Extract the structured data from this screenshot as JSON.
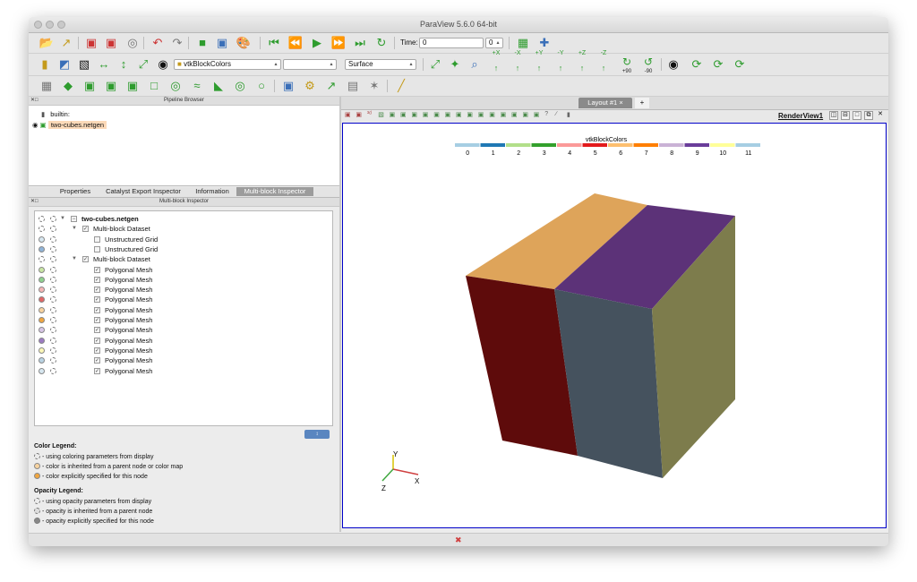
{
  "window": {
    "title": "ParaView 5.6.0 64-bit"
  },
  "toolbar": {
    "time_label": "Time:",
    "time_value": "0",
    "time_index": "0",
    "color_by": "vtkBlockColors",
    "component": "",
    "representation": "Surface",
    "rot_plus_90": "+90",
    "rot_minus_90": "-90",
    "axis_buttons": [
      "+X",
      "-X",
      "+Y",
      "-Y",
      "+Z",
      "-Z"
    ]
  },
  "pipeline": {
    "title": "Pipeline Browser",
    "items": [
      {
        "label": "builtin:"
      },
      {
        "label": "two-cubes.netgen"
      }
    ]
  },
  "tabs": [
    "Properties",
    "Catalyst Export Inspector",
    "Information",
    "Multi-block Inspector"
  ],
  "inspector": {
    "title": "Multi-block Inspector",
    "rows": [
      {
        "label": "two-cubes.netgen",
        "level": 0,
        "bold": true,
        "circle": "dash",
        "expand": "▼"
      },
      {
        "label": "Multi-block Dataset",
        "level": 1,
        "circle": "dash",
        "expand": "▼"
      },
      {
        "label": "Unstructured Grid",
        "level": 2,
        "circle": "#d7e7f0",
        "expand": ""
      },
      {
        "label": "Unstructured Grid",
        "level": 2,
        "circle": "#90b4d8",
        "expand": ""
      },
      {
        "label": "Multi-block Dataset",
        "level": 1,
        "circle": "dash",
        "expand": "▼"
      },
      {
        "label": "Polygonal Mesh",
        "level": 2,
        "circle": "#c9e6a4",
        "expand": ""
      },
      {
        "label": "Polygonal Mesh",
        "level": 2,
        "circle": "#8fd18f",
        "expand": ""
      },
      {
        "label": "Polygonal Mesh",
        "level": 2,
        "circle": "#f4b6b6",
        "expand": ""
      },
      {
        "label": "Polygonal Mesh",
        "level": 2,
        "circle": "#e06666",
        "expand": ""
      },
      {
        "label": "Polygonal Mesh",
        "level": 2,
        "circle": "#f7d3a0",
        "expand": ""
      },
      {
        "label": "Polygonal Mesh",
        "level": 2,
        "circle": "#f0a640",
        "expand": ""
      },
      {
        "label": "Polygonal Mesh",
        "level": 2,
        "circle": "#d7c6e6",
        "expand": ""
      },
      {
        "label": "Polygonal Mesh",
        "level": 2,
        "circle": "#9c7bc2",
        "expand": ""
      },
      {
        "label": "Polygonal Mesh",
        "level": 2,
        "circle": "#fbf7b8",
        "expand": ""
      },
      {
        "label": "Polygonal Mesh",
        "level": 2,
        "circle": "#b9d3e3",
        "expand": ""
      },
      {
        "label": "Polygonal Mesh",
        "level": 2,
        "circle": "#d7e7f0",
        "expand": ""
      }
    ]
  },
  "legend": {
    "color_title": "Color Legend:",
    "color_items": [
      "- using coloring parameters from display",
      "- color is inherited from a parent node or color map",
      "- color explicitly specified for this node"
    ],
    "opacity_title": "Opacity Legend:",
    "opacity_items": [
      "- using opacity parameters from display",
      "- opacity is inherited from a parent node",
      "- opacity explicitly specified for this node"
    ]
  },
  "layout": {
    "tab_label": "Layout #1",
    "tab_close": "×",
    "add_tab": "+",
    "view_name": "RenderView1"
  },
  "colorbar": {
    "title": "vtkBlockColors",
    "labels": [
      "0",
      "1",
      "2",
      "3",
      "4",
      "5",
      "6",
      "7",
      "8",
      "9",
      "10",
      "11"
    ],
    "colors": [
      "#a6cee3",
      "#1f78b4",
      "#b2df8a",
      "#33a02c",
      "#fb9a99",
      "#e31a1c",
      "#fdbf6f",
      "#ff7f00",
      "#cab2d6",
      "#6a3d9a",
      "#ffff99",
      "#a6cee3"
    ]
  },
  "cube": {
    "colors": {
      "top_left": "#dea45a",
      "top_right": "#5c3278",
      "front_left": "#5e0b0b",
      "front_right": "#45525e",
      "side": "#7d7c4c"
    }
  },
  "axes": {
    "x": "X",
    "y": "Y",
    "z": "Z"
  },
  "colors": {
    "accent": "#0000c8",
    "selection": "#fbd9b8"
  }
}
